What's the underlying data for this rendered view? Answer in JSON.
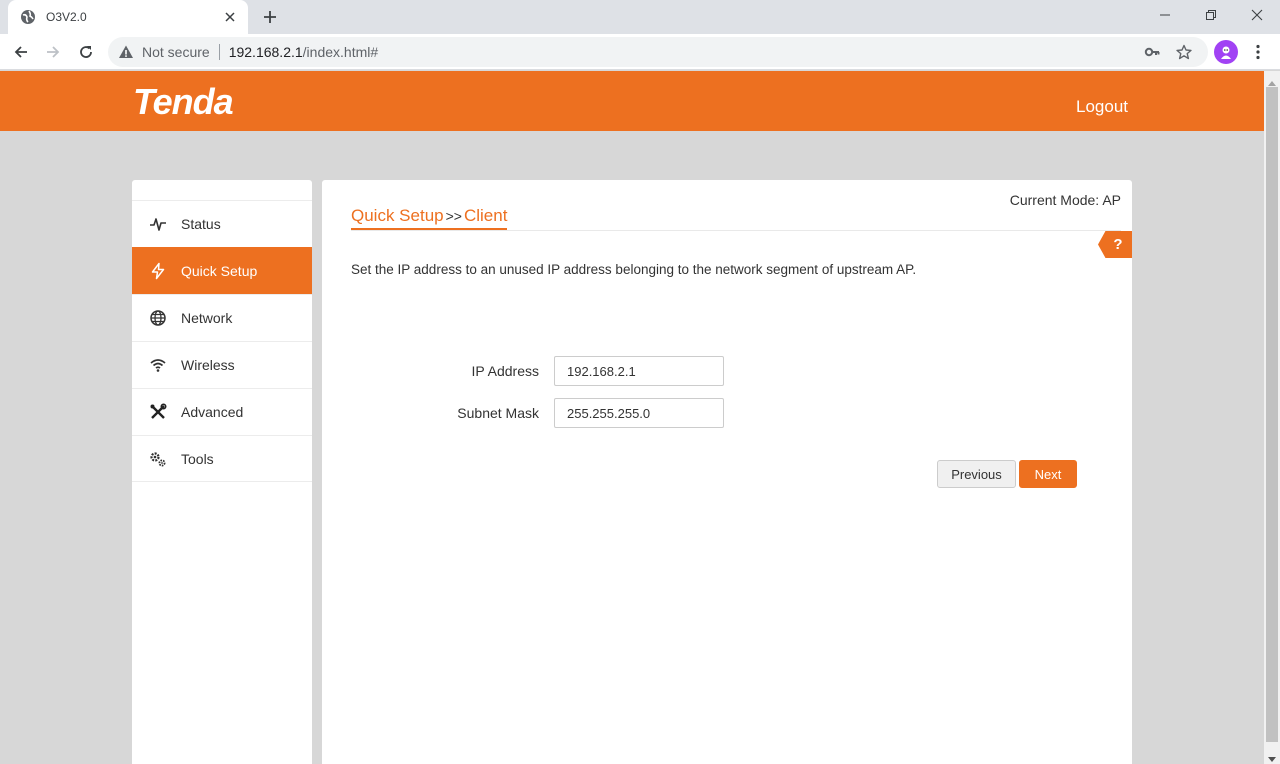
{
  "browser": {
    "tab_title": "O3V2.0",
    "security_label": "Not secure",
    "url_host": "192.168.2.1",
    "url_path": "/index.html#"
  },
  "header": {
    "logo_text": "Tenda",
    "logout_label": "Logout",
    "accent_color": "#ed7020"
  },
  "sidebar": {
    "items": [
      {
        "label": "Status",
        "icon": "pulse-icon",
        "active": false
      },
      {
        "label": "Quick Setup",
        "icon": "lightning-icon",
        "active": true
      },
      {
        "label": "Network",
        "icon": "globe-icon",
        "active": false
      },
      {
        "label": "Wireless",
        "icon": "wifi-icon",
        "active": false
      },
      {
        "label": "Advanced",
        "icon": "tools-cross-icon",
        "active": false
      },
      {
        "label": "Tools",
        "icon": "gears-icon",
        "active": false
      }
    ]
  },
  "main": {
    "current_mode": "Current Mode: AP",
    "breadcrumb_parent": "Quick Setup",
    "breadcrumb_separator": ">>",
    "breadcrumb_current": "Client",
    "help_label": "?",
    "description": "Set the IP address to an unused IP address belonging to the network segment of upstream AP.",
    "fields": {
      "ip_label": "IP Address",
      "ip_value": "192.168.2.1",
      "mask_label": "Subnet Mask",
      "mask_value": "255.255.255.0"
    },
    "previous_label": "Previous",
    "next_label": "Next"
  }
}
